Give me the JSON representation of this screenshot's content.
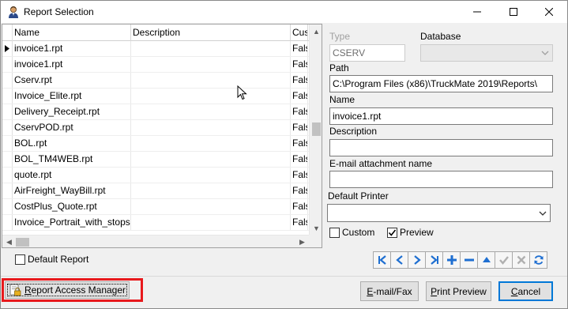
{
  "window": {
    "title": "Report Selection",
    "controls": {
      "minimize": "minimize",
      "maximize": "maximize",
      "close": "close"
    }
  },
  "grid": {
    "columns": [
      {
        "label": "Name"
      },
      {
        "label": "Description"
      },
      {
        "label": "Cus"
      }
    ],
    "rows": [
      {
        "name": "invoice1.rpt",
        "description": "",
        "custom": "False",
        "current": true
      },
      {
        "name": "invoice1.rpt",
        "description": "",
        "custom": "False",
        "current": false
      },
      {
        "name": "Cserv.rpt",
        "description": "",
        "custom": "False",
        "current": false
      },
      {
        "name": "Invoice_Elite.rpt",
        "description": "",
        "custom": "False",
        "current": false
      },
      {
        "name": "Delivery_Receipt.rpt",
        "description": "",
        "custom": "False",
        "current": false
      },
      {
        "name": "CservPOD.rpt",
        "description": "",
        "custom": "False",
        "current": false
      },
      {
        "name": "BOL.rpt",
        "description": "",
        "custom": "False",
        "current": false
      },
      {
        "name": "BOL_TM4WEB.rpt",
        "description": "",
        "custom": "False",
        "current": false
      },
      {
        "name": "quote.rpt",
        "description": "",
        "custom": "False",
        "current": false
      },
      {
        "name": "AirFreight_WayBill.rpt",
        "description": "",
        "custom": "False",
        "current": false
      },
      {
        "name": "CostPlus_Quote.rpt",
        "description": "",
        "custom": "False",
        "current": false
      },
      {
        "name": "Invoice_Portrait_with_stops.rpt",
        "description": "",
        "custom": "False",
        "current": false
      }
    ]
  },
  "form": {
    "type_label": "Type",
    "type_value": "CSERV",
    "database_label": "Database",
    "database_value": "",
    "path_label": "Path",
    "path_value": "C:\\Program Files (x86)\\TruckMate 2019\\Reports\\",
    "name_label": "Name",
    "name_value": "invoice1.rpt",
    "description_label": "Description",
    "description_value": "",
    "email_label": "E-mail attachment name",
    "email_value": "",
    "printer_label": "Default Printer",
    "printer_value": "",
    "custom_label": "Custom",
    "custom_checked": false,
    "preview_label": "Preview",
    "preview_checked": true
  },
  "default_report": {
    "label": "Default Report",
    "checked": false
  },
  "navigator": [
    {
      "name": "nav-first-button",
      "icon": "first-icon",
      "enabled": true
    },
    {
      "name": "nav-prior-button",
      "icon": "prior-icon",
      "enabled": true
    },
    {
      "name": "nav-next-button",
      "icon": "next-icon",
      "enabled": true
    },
    {
      "name": "nav-last-button",
      "icon": "last-icon",
      "enabled": true
    },
    {
      "name": "nav-insert-button",
      "icon": "plus-icon",
      "enabled": true
    },
    {
      "name": "nav-delete-button",
      "icon": "minus-icon",
      "enabled": true
    },
    {
      "name": "nav-edit-button",
      "icon": "up-triangle-icon",
      "enabled": true
    },
    {
      "name": "nav-post-button",
      "icon": "check-icon",
      "enabled": false
    },
    {
      "name": "nav-cancel-button",
      "icon": "x-icon",
      "enabled": false
    },
    {
      "name": "nav-refresh-button",
      "icon": "refresh-icon",
      "enabled": true
    }
  ],
  "buttons": {
    "report_access_manager": {
      "label_first": "R",
      "label_rest": "eport Access Manager"
    },
    "email_fax": {
      "label_first": "E",
      "label_rest": "-mail/Fax"
    },
    "print_preview": {
      "label_first": "P",
      "label_rest": "rint Preview"
    },
    "cancel": {
      "label_first": "C",
      "label_rest": "ancel"
    }
  },
  "colors": {
    "nav_blue": "#1f6fd1",
    "highlight_red": "#e8191c",
    "disabled_gray": "#b0b0b0"
  }
}
